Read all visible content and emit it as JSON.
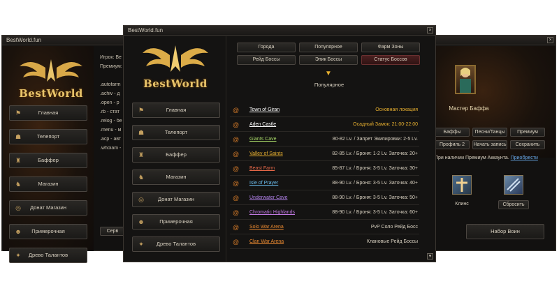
{
  "left_window": {
    "title": "BestWorld.fun",
    "logo_text": "BestWorld",
    "nav": [
      "Главная",
      "Телепорт",
      "Баффер",
      "Магазин",
      "Донат Магазин",
      "Примерочная",
      "Древо Талантов"
    ],
    "side_lines": [
      "Игрок: Be",
      "Премиум: ",
      "",
      ".autofarm",
      ".achiv - д",
      ".open - р",
      ".rb - стат",
      ".relog - бе",
      ".menu - м",
      ".acp - авт",
      ".whoiam - "
    ],
    "bottom_label": "Серв"
  },
  "right_window": {
    "title": "",
    "hero_label": "Мастер Баффа",
    "buttons_row1": [
      "Баффы",
      "Песни/Танцы",
      "Премиум"
    ],
    "buttons_row2": [
      "Профиль 2",
      "Начать запись",
      "Сохранить"
    ],
    "premium_note": "При наличии Премиум Аккаунта.",
    "premium_link": "Приобрести",
    "skill1_label": "Клинс",
    "skill2_label": "Сбросить",
    "bottom_button": "Набор Воин"
  },
  "main_window": {
    "title": "BestWorld.fun",
    "logo_text": "BestWorld",
    "nav": [
      "Главная",
      "Телепорт",
      "Баффер",
      "Магазин",
      "Донат Магазин",
      "Примерочная",
      "Древо Талантов"
    ],
    "tabs_row1": [
      "Города",
      "Популярное",
      "Фарм Зоны"
    ],
    "tabs_row2": [
      "Рейд Боссы",
      "Эпик Боссы",
      "Статус Боссов"
    ],
    "section_title": "Популярное",
    "locations": [
      {
        "name": "Town of Giran",
        "desc": "Основная локация",
        "name_color": "#ffffff",
        "desc_color": "#e8b030"
      },
      {
        "name": "Aden Castle",
        "desc": "Осадный Замок: 21:00-22:00",
        "name_color": "#ffffff",
        "desc_color": "#e8b030"
      },
      {
        "name": "Giants Cave",
        "desc": "80-82 Lv. / Запрет Экипировки: 2-5 Lv.",
        "name_color": "#a8d868",
        "desc_color": "#d8d0c0"
      },
      {
        "name": "Valley of Saints",
        "desc": "82-85 Lv. / Броня: 1-2 Lv. Заточка: 20+",
        "name_color": "#e8b030",
        "desc_color": "#d8d0c0"
      },
      {
        "name": "Beast Farm",
        "desc": "85-87 Lv. / Броня: 3-5 Lv. Заточка: 30+",
        "name_color": "#e86848",
        "desc_color": "#d8d0c0"
      },
      {
        "name": "Isle of Prayer",
        "desc": "88-90 Lv. / Броня: 3-5 Lv. Заточка: 40+",
        "name_color": "#68b8e8",
        "desc_color": "#d8d0c0"
      },
      {
        "name": "Underwater Cave",
        "desc": "88-90 Lv. / Броня: 3-5 Lv. Заточка: 50+",
        "name_color": "#b080e8",
        "desc_color": "#d8d0c0"
      },
      {
        "name": "Chromatic Highlands",
        "desc": "88-90 Lv. / Броня: 3-5 Lv. Заточка: 60+",
        "name_color": "#c078e0",
        "desc_color": "#d8d0c0"
      },
      {
        "name": "Solo War Arena",
        "desc": "PvP Соло Рейд Босс",
        "name_color": "#e88830",
        "desc_color": "#d8d0c0"
      },
      {
        "name": "Clan War Arena",
        "desc": "Клановые Рейд Боссы",
        "name_color": "#e88830",
        "desc_color": "#d8d0c0"
      }
    ]
  }
}
